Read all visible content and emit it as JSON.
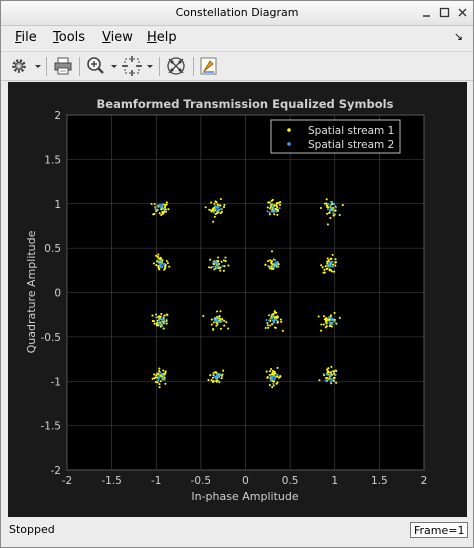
{
  "window": {
    "title": "Constellation Diagram"
  },
  "menu": {
    "items": [
      {
        "label": "File",
        "accel": "F",
        "rest": "ile"
      },
      {
        "label": "Tools",
        "accel": "T",
        "rest": "ools"
      },
      {
        "label": "View",
        "accel": "V",
        "rest": "iew"
      },
      {
        "label": "Help",
        "accel": "H",
        "rest": "elp"
      }
    ]
  },
  "toolbar": {
    "icons": [
      "gear-icon",
      "printer-icon",
      "zoom-in-icon",
      "fit-to-view-icon",
      "constellation-icon",
      "highlight-icon"
    ]
  },
  "status": {
    "text": "Stopped",
    "frame": "Frame=1"
  },
  "colors": {
    "plot_bg": "#1a1a1a",
    "axes_bg": "#000000",
    "grid": "#4a4a4a",
    "text": "#cfcfcf",
    "series1": "#ffff00",
    "series2": "#3ba3ec"
  },
  "chart_data": {
    "type": "scatter",
    "title": "Beamformed Transmission Equalized Symbols",
    "xlabel": "In-phase Amplitude",
    "ylabel": "Quadrature Amplitude",
    "xlim": [
      -2,
      2
    ],
    "ylim": [
      -2,
      2
    ],
    "xticks": [
      "-2",
      "-1.5",
      "-1",
      "-0.5",
      "0",
      "0.5",
      "1",
      "1.5",
      "2"
    ],
    "yticks": [
      "2",
      "1.5",
      "1",
      "0.5",
      "0",
      "-0.5",
      "-1",
      "-1.5",
      "-2"
    ],
    "grid": true,
    "legend_position": "top-right",
    "constellation_points": [
      -0.9487,
      -0.3162,
      0.3162,
      0.9487
    ],
    "series": [
      {
        "name": "Spatial stream 1",
        "color": "#ffff00"
      },
      {
        "name": "Spatial stream 2",
        "color": "#3ba3ec"
      }
    ]
  }
}
